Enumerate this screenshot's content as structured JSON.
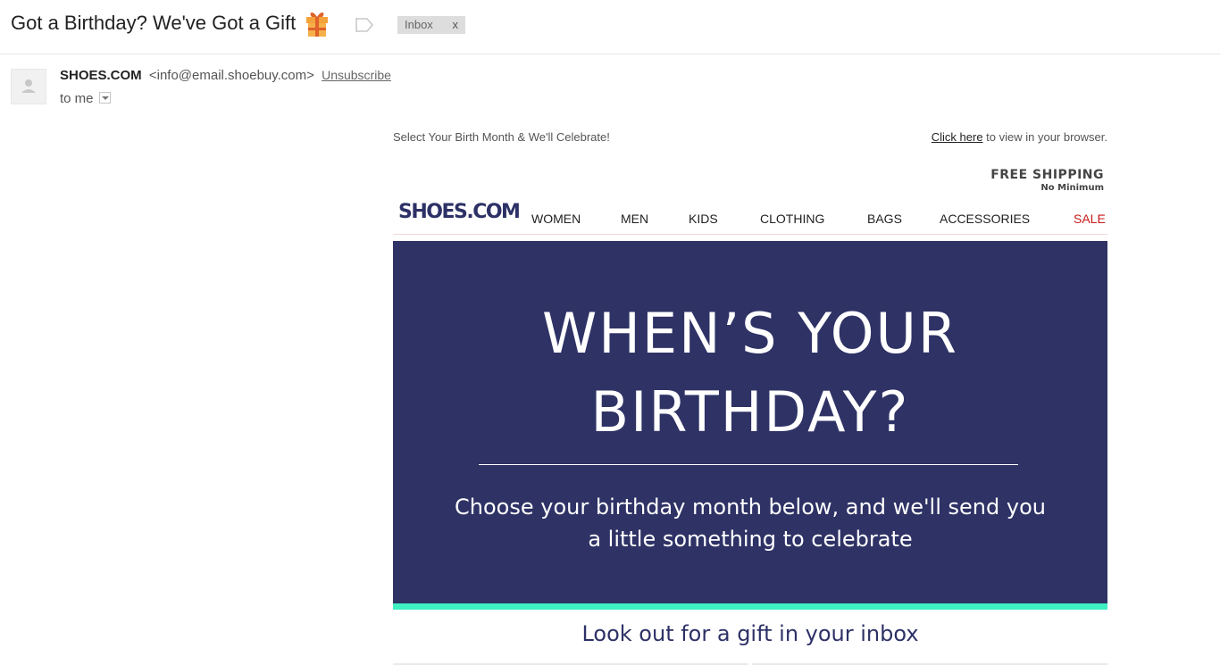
{
  "email": {
    "subject": "Got a Birthday? We've Got a Gift",
    "label_chip": "Inbox",
    "label_remove": "x",
    "sender_name": "SHOES.COM",
    "sender_email": "<info@email.shoebuy.com>",
    "unsubscribe": "Unsubscribe",
    "recipient": "to me"
  },
  "icons": {
    "subject_emoji": "gift-icon",
    "label": "label-icon",
    "avatar": "person-icon",
    "details": "chevron-down-icon"
  },
  "content": {
    "preheader": "Select Your Birth Month & We'll Celebrate!",
    "browser_link": "Click here",
    "browser_text": " to view in your browser.",
    "free_shipping": "FREE SHIPPING",
    "no_minimum": "No Minimum",
    "logo": "SHOES.COM",
    "nav": [
      "WOMEN",
      "MEN",
      "KIDS",
      "CLOTHING",
      "BAGS",
      "ACCESSORIES",
      "SALE"
    ],
    "hero_title": "WHEN’S YOUR\nBIRTHDAY?",
    "hero_subtitle": "Choose your birthday month below, and we'll send you a little something to celebrate",
    "lookout": "Look out for a gift in your inbox"
  },
  "colors": {
    "brand_navy": "#2e3265",
    "accent_mint": "#3ef0c2",
    "sale_red": "#c81a1a"
  }
}
